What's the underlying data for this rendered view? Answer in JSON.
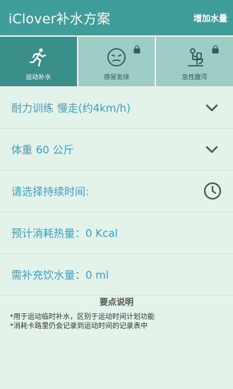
{
  "appbar": {
    "title": "iClover补水方案",
    "action_label": "增加水量"
  },
  "tabs": [
    {
      "label": "运动补水",
      "icon": "running-person-icon",
      "active": true,
      "locked": false
    },
    {
      "label": "感冒发烧",
      "icon": "sick-face-icon",
      "active": false,
      "locked": true
    },
    {
      "label": "急性腹泻",
      "icon": "toilet-person-icon",
      "active": false,
      "locked": true
    }
  ],
  "rows": {
    "exercise": {
      "text": "耐力训练 慢走(约4km/h)",
      "icon": "chevron-down-icon"
    },
    "weight": {
      "text": "体重 60 公斤",
      "icon": "chevron-down-icon"
    },
    "duration": {
      "text": "请选择持续时间:",
      "icon": "clock-icon"
    },
    "calories": {
      "text": "预计消耗热量：0 Kcal"
    },
    "water": {
      "text": "需补充饮水量：0 ml"
    }
  },
  "notes": {
    "title": "要点说明",
    "lines": [
      "*用于运动临时补水，区别于运动时间计划功能",
      "*消耗卡路里仍会记录到运动时间的记录表中"
    ]
  },
  "colors": {
    "primary": "#3f9e99",
    "active_tab": "#3b8f8b",
    "inactive_tab": "#9dcdc4",
    "background": "#e4f3ea",
    "accent_text": "#3b9ec4"
  }
}
